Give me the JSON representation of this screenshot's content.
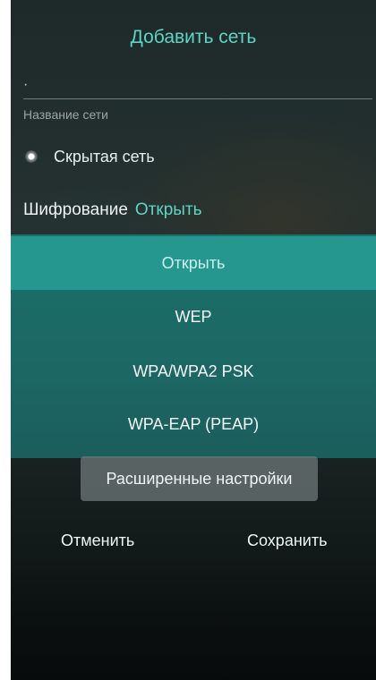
{
  "dialog": {
    "title": "Добавить сеть",
    "network_name": {
      "value": "·",
      "label": "Название сети"
    },
    "hidden_network": {
      "label": "Скрытая сеть",
      "checked": false
    },
    "encryption": {
      "label": "Шифрование",
      "value": "Открыть"
    },
    "encryption_options": [
      {
        "label": "Открыть",
        "selected": true
      },
      {
        "label": "WEP",
        "selected": false
      },
      {
        "label": "WPA/WPA2 PSK",
        "selected": false
      },
      {
        "label": "WPA-EAP (PEAP)",
        "selected": false
      }
    ],
    "advanced_button": "Расширенные настройки",
    "cancel_button": "Отменить",
    "save_button": "Сохранить"
  },
  "colors": {
    "accent": "#5fd3c6",
    "menu_background": "#1c6764",
    "menu_selected": "#25978f"
  }
}
